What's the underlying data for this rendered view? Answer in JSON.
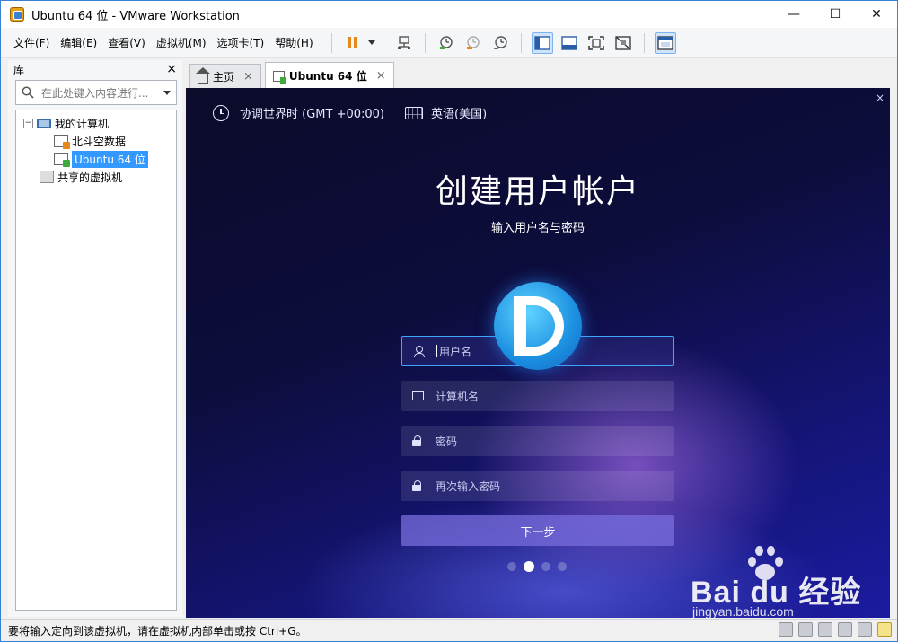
{
  "window": {
    "title": "Ubuntu 64 位 - VMware Workstation",
    "controls": {
      "minimize": "—",
      "maximize": "☐",
      "close": "✕"
    }
  },
  "menubar": {
    "items": [
      "文件(F)",
      "编辑(E)",
      "查看(V)",
      "虚拟机(M)",
      "选项卡(T)",
      "帮助(H)"
    ]
  },
  "library": {
    "title": "库",
    "close": "×",
    "search_placeholder": "在此处键入内容进行...",
    "tree": {
      "root": "我的计算机",
      "children": [
        "北斗空数据",
        "Ubuntu 64 位"
      ],
      "shared": "共享的虚拟机",
      "expander": "−"
    }
  },
  "tabs": [
    {
      "label": "主页",
      "close": "×"
    },
    {
      "label": "Ubuntu 64 位",
      "close": "×"
    }
  ],
  "vm": {
    "close": "×",
    "timezone": "协调世界时 (GMT +00:00)",
    "keyboard": "英语(美国)",
    "heading": "创建用户帐户",
    "subheading": "输入用户名与密码",
    "fields": {
      "username_placeholder": "用户名",
      "computer_placeholder": "计算机名",
      "password_placeholder": "密码",
      "confirm_placeholder": "再次输入密码"
    },
    "next_button": "下一步",
    "pager": {
      "total": 4,
      "active_index": 1
    }
  },
  "watermark": {
    "brand": "Bai du 经验",
    "url": "jingyan.baidu.com"
  },
  "statusbar": {
    "message": "要将输入定向到该虚拟机，请在虚拟机内部单击或按 Ctrl+G。"
  },
  "colors": {
    "accent": "#3399ff",
    "vm_background": "#0d0d3d",
    "pause_orange": "#e6891b"
  }
}
